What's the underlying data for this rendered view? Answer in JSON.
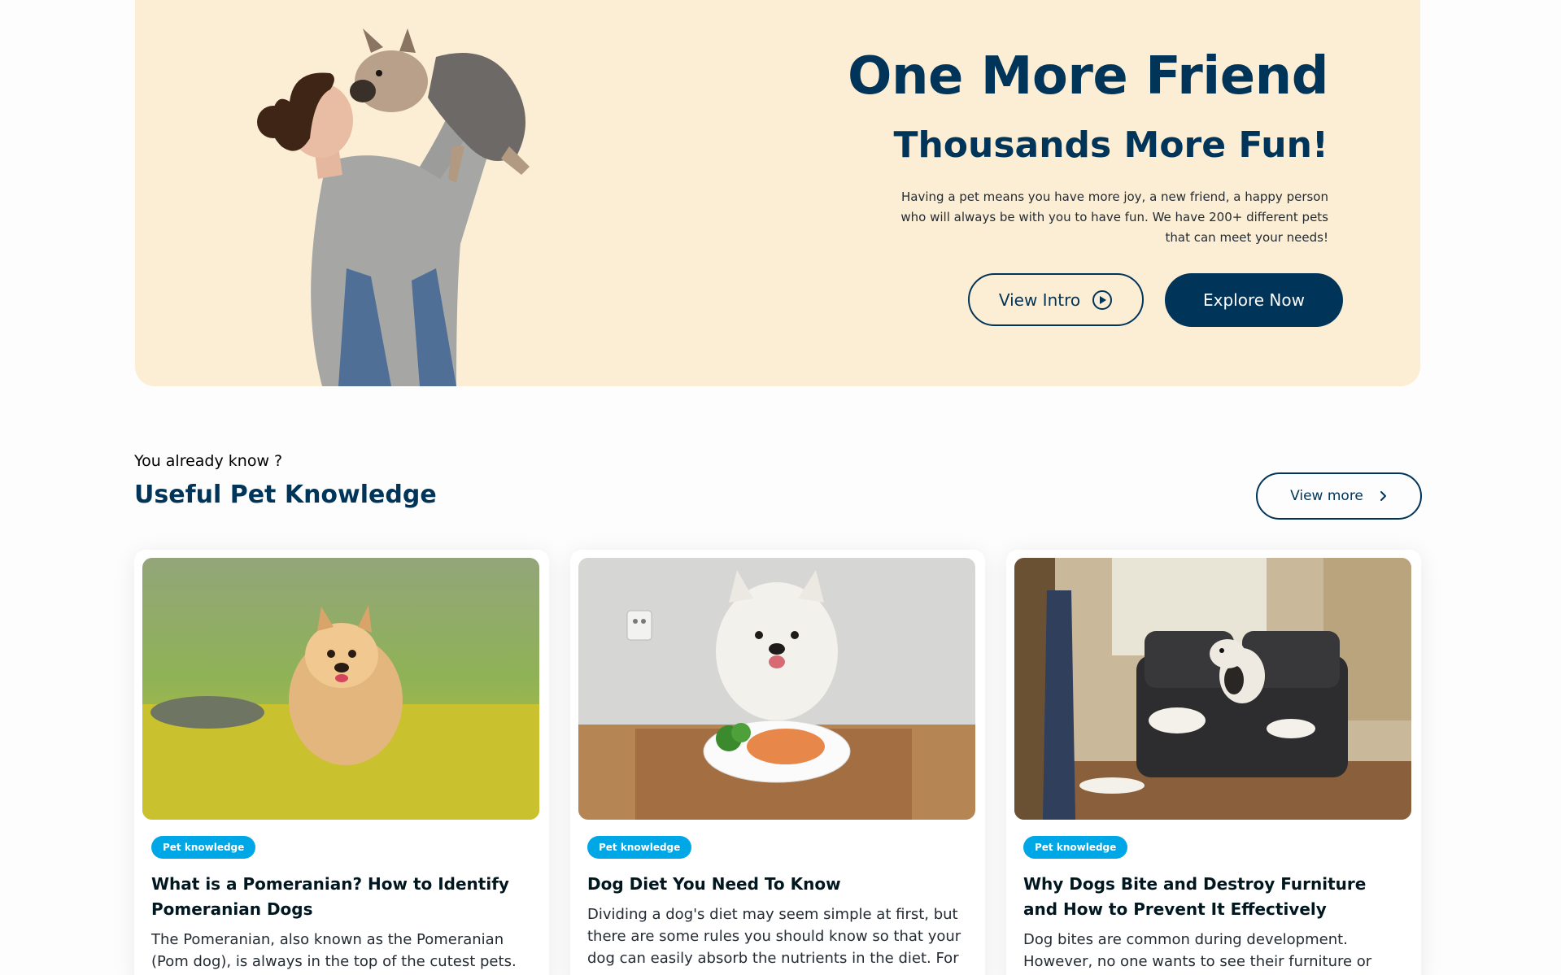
{
  "hero": {
    "title": "One More Friend",
    "subtitle": "Thousands More Fun!",
    "description": "Having a pet means you have more joy, a new friend, a happy person who will always be with you to have fun. We have 200+ different pets that can meet your needs!",
    "view_intro_label": "View Intro",
    "explore_label": "Explore Now",
    "background_color": "#fceed5",
    "accent_color": "#003459"
  },
  "knowledge": {
    "eyebrow": "You already know ?",
    "title": "Useful Pet Knowledge",
    "view_more_label": "View more",
    "badge_color": "#00a7e7",
    "cards": [
      {
        "badge": "Pet knowledge",
        "title": "What is a Pomeranian? How to Identify Pomeranian Dogs",
        "text": "The Pomeranian, also known as the Pomeranian (Pom dog), is always in the top of the cutest pets. Not only",
        "image": "pomeranian-running-photo"
      },
      {
        "badge": "Pet knowledge",
        "title": "Dog Diet You Need To Know",
        "text": "Dividing a dog's diet may seem simple at first, but there are some rules you should know so that your dog can easily absorb the nutrients in the diet. For",
        "image": "samoyed-dinner-photo"
      },
      {
        "badge": "Pet knowledge",
        "title": "Why Dogs Bite and Destroy Furniture and How to Prevent It Effectively",
        "text": "Dog bites are common during development. However, no one wants to see their furniture or important items",
        "image": "dog-destroyed-sofa-photo"
      }
    ]
  },
  "icons": {
    "play": "play-circle-icon",
    "chevron": "chevron-right-icon"
  }
}
